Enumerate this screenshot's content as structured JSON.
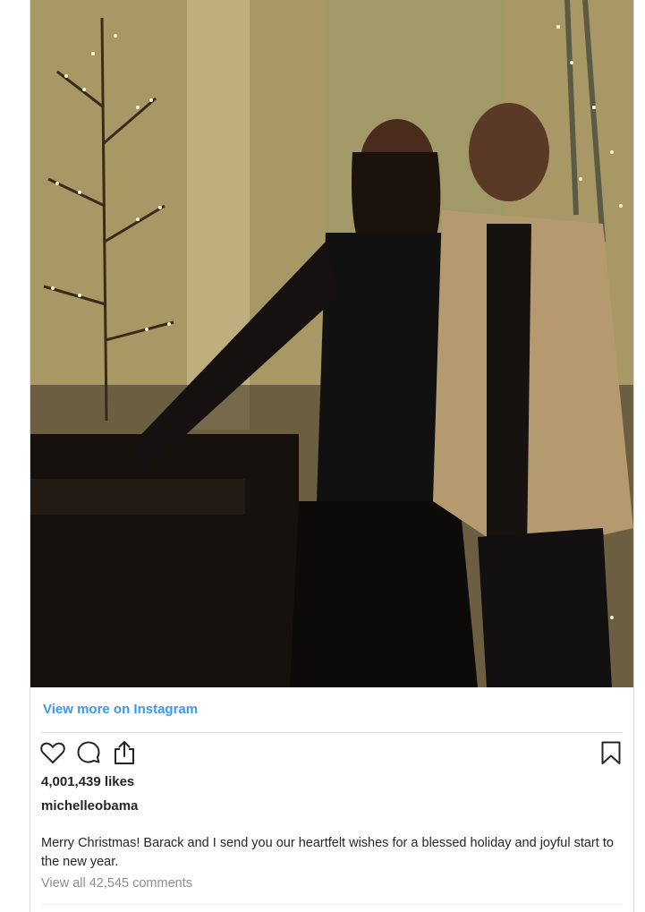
{
  "post": {
    "view_more_label": "View more on Instagram",
    "likes_text": "4,001,439 likes",
    "username": "michelleobama",
    "caption": "Merry Christmas! Barack and I send you our heartfelt wishes for a blessed holiday and joyful start to the new year.",
    "comments_link": "View all 42,545 comments"
  },
  "icons": {
    "like": "heart-icon",
    "comment": "comment-bubble-icon",
    "share": "share-upload-icon",
    "save": "bookmark-icon"
  },
  "colors": {
    "link_blue": "#3897f0",
    "text": "#262626",
    "muted": "#8e8e8e",
    "border": "#dbdbdb"
  }
}
